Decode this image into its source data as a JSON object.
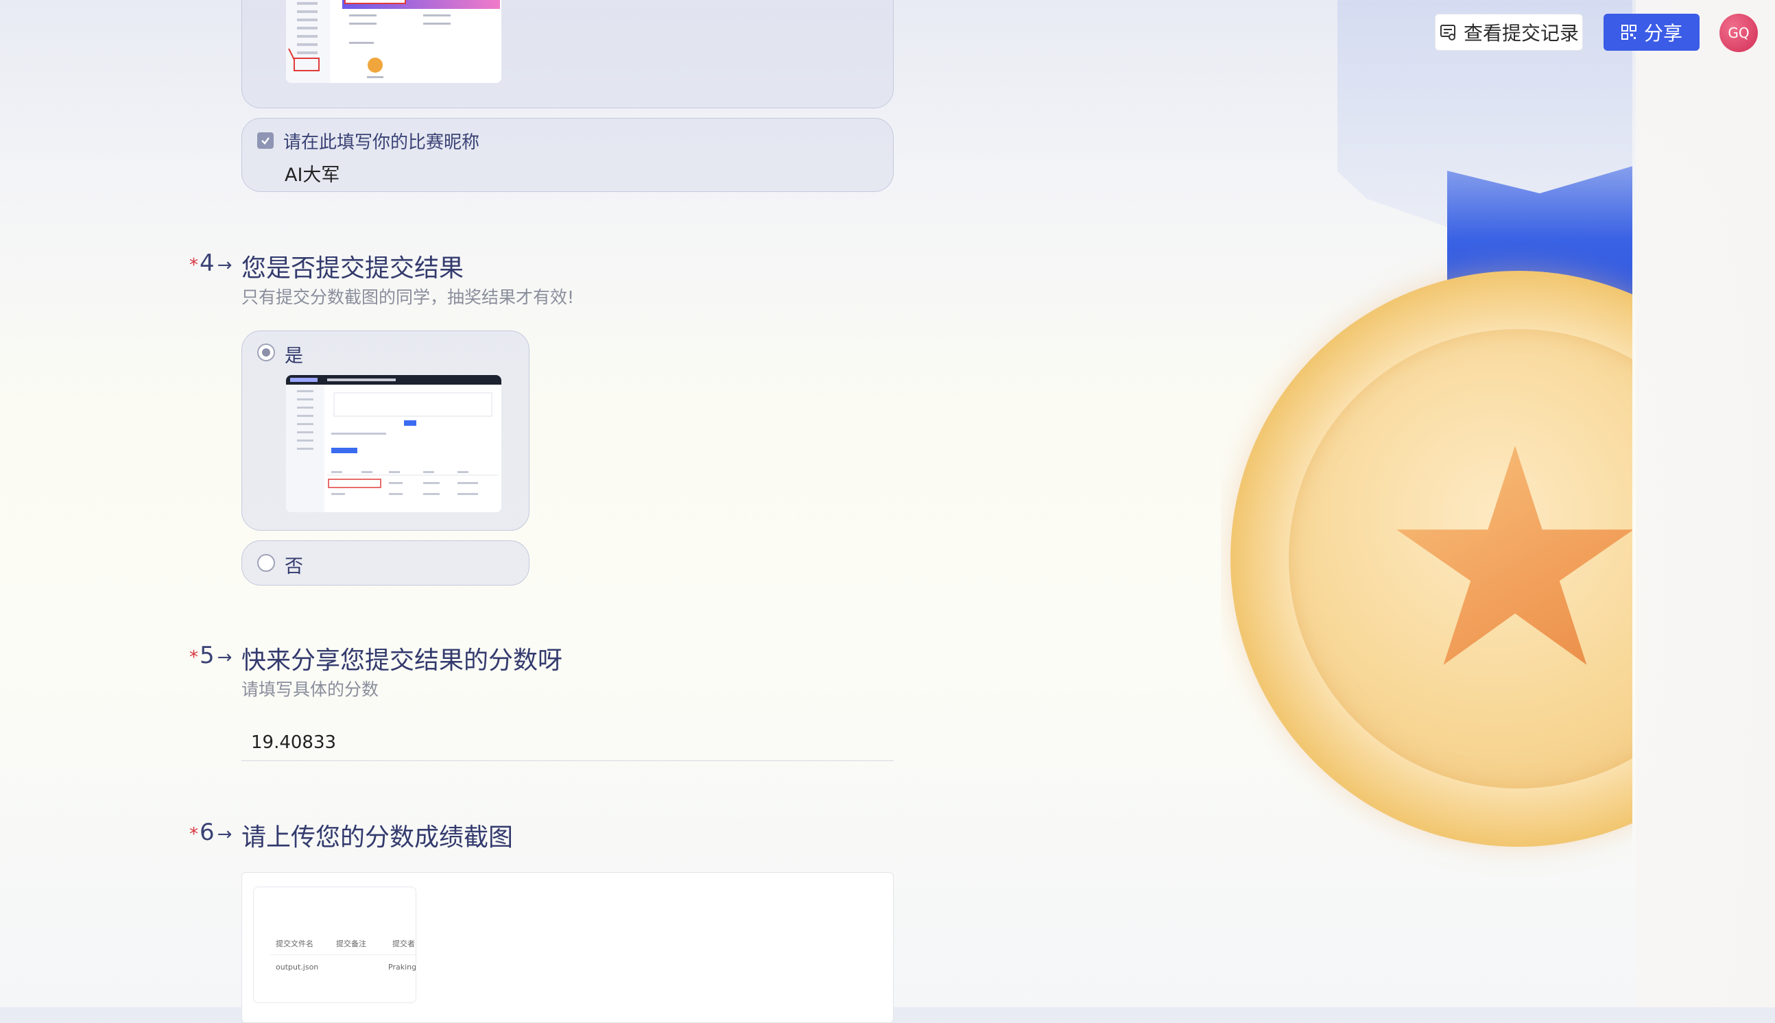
{
  "header": {
    "records_label": "查看提交记录",
    "share_label": "分享",
    "avatar_initials": "GQ"
  },
  "q3": {
    "nickname_prompt": "请在此填写你的比赛昵称",
    "nickname_value": "AI大军"
  },
  "q4": {
    "number": "4",
    "title": "您是否提交提交结果",
    "description": "只有提交分数截图的同学，抽奖结果才有效!",
    "options": [
      {
        "label": "是",
        "selected": true
      },
      {
        "label": "否",
        "selected": false
      }
    ]
  },
  "q5": {
    "number": "5",
    "title": "快来分享您提交结果的分数呀",
    "description": "请填写具体的分数",
    "value": "19.40833"
  },
  "q6": {
    "number": "6",
    "title": "请上传您的分数成绩截图",
    "thumbnail": {
      "columns": [
        "提交文件名",
        "提交备注",
        "提交者"
      ],
      "row": [
        "output.json",
        "",
        "PrakingD"
      ]
    }
  },
  "colors": {
    "accent": "#3b5ce6",
    "required": "#d8343e",
    "title": "#333a6d"
  }
}
